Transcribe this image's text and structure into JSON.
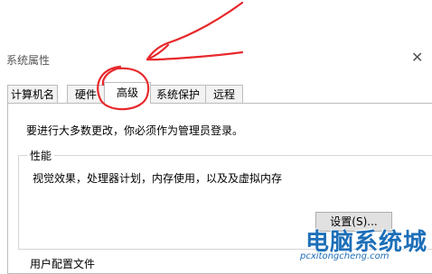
{
  "window": {
    "title": "系统属性",
    "close_glyph": "✕"
  },
  "tabs": [
    {
      "label": "计算机名",
      "active": false
    },
    {
      "label": "硬件",
      "active": false
    },
    {
      "label": "高级",
      "active": true
    },
    {
      "label": "系统保护",
      "active": false
    },
    {
      "label": "远程",
      "active": false
    }
  ],
  "advanced": {
    "admin_notice": "要进行大多数更改，你必须作为管理员登录。",
    "performance": {
      "title": "性能",
      "description": "视觉效果，处理器计划，内存使用，以及及虚拟内存",
      "settings_button": "设置(S)..."
    },
    "user_profiles": {
      "title": "用户配置文件"
    }
  },
  "watermark": {
    "main": "电脑系统城",
    "sub": "pcxitongcheng.com"
  },
  "colors": {
    "annotation_red": "#e8282b",
    "watermark_blue": "#1d6fb8"
  }
}
